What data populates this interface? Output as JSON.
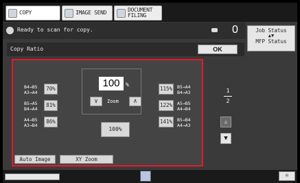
{
  "tabs": [
    {
      "label": "COPY",
      "active": true
    },
    {
      "label": "IMAGE SEND",
      "active": false
    },
    {
      "label": "DOCUMENT FILING",
      "active": false
    }
  ],
  "status": {
    "message": "Ready to scan for copy.",
    "count": "0"
  },
  "job_status": {
    "line1": "Job Status",
    "arrows": "▲▼",
    "line2": "MFP Status"
  },
  "screen": {
    "title": "Copy Ratio",
    "ok_label": "OK"
  },
  "left_presets": [
    {
      "from_to": "B4→B5\nA3→A4",
      "pct": "70%"
    },
    {
      "from_to": "B5→A5\nB4→A4",
      "pct": "81%"
    },
    {
      "from_to": "A4→B5\nA3→B4",
      "pct": "86%"
    }
  ],
  "right_presets": [
    {
      "pct": "115%",
      "from_to": "B5→A4\nB4→A3"
    },
    {
      "pct": "122%",
      "from_to": "A5→B5\nA4→B4"
    },
    {
      "pct": "141%",
      "from_to": "B5→B4\nA4→A3"
    }
  ],
  "zoom": {
    "value": "100",
    "unit": "%",
    "label": "Zoom",
    "down_icon": "chevron-down-double",
    "up_icon": "chevron-up-double"
  },
  "reset_label": "100%",
  "bottom_tabs": [
    "Auto Image",
    "XY Zoom"
  ],
  "page": {
    "current": "1",
    "total": "2"
  },
  "colors": {
    "highlight_border": "#e8182a",
    "background": "#3a3a3a"
  }
}
